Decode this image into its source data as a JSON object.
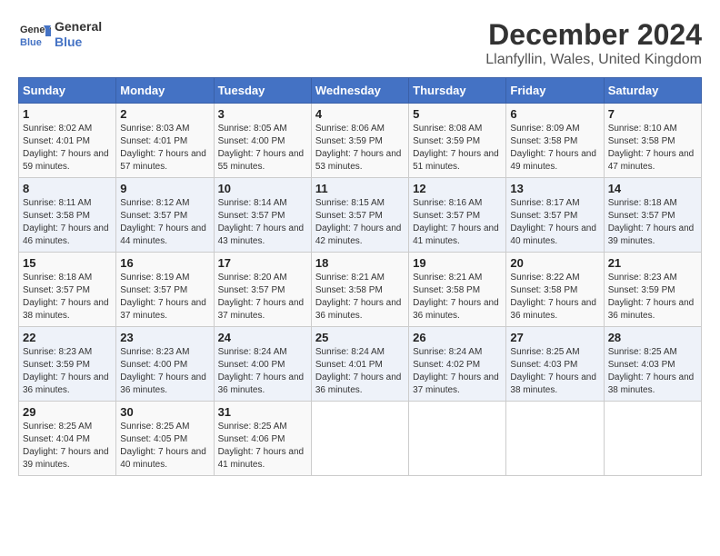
{
  "header": {
    "logo_line1": "General",
    "logo_line2": "Blue",
    "title": "December 2024",
    "subtitle": "Llanfyllin, Wales, United Kingdom"
  },
  "days_of_week": [
    "Sunday",
    "Monday",
    "Tuesday",
    "Wednesday",
    "Thursday",
    "Friday",
    "Saturday"
  ],
  "weeks": [
    [
      {
        "day": "1",
        "sunrise": "8:02 AM",
        "sunset": "4:01 PM",
        "daylight": "7 hours and 59 minutes."
      },
      {
        "day": "2",
        "sunrise": "8:03 AM",
        "sunset": "4:01 PM",
        "daylight": "7 hours and 57 minutes."
      },
      {
        "day": "3",
        "sunrise": "8:05 AM",
        "sunset": "4:00 PM",
        "daylight": "7 hours and 55 minutes."
      },
      {
        "day": "4",
        "sunrise": "8:06 AM",
        "sunset": "3:59 PM",
        "daylight": "7 hours and 53 minutes."
      },
      {
        "day": "5",
        "sunrise": "8:08 AM",
        "sunset": "3:59 PM",
        "daylight": "7 hours and 51 minutes."
      },
      {
        "day": "6",
        "sunrise": "8:09 AM",
        "sunset": "3:58 PM",
        "daylight": "7 hours and 49 minutes."
      },
      {
        "day": "7",
        "sunrise": "8:10 AM",
        "sunset": "3:58 PM",
        "daylight": "7 hours and 47 minutes."
      }
    ],
    [
      {
        "day": "8",
        "sunrise": "8:11 AM",
        "sunset": "3:58 PM",
        "daylight": "7 hours and 46 minutes."
      },
      {
        "day": "9",
        "sunrise": "8:12 AM",
        "sunset": "3:57 PM",
        "daylight": "7 hours and 44 minutes."
      },
      {
        "day": "10",
        "sunrise": "8:14 AM",
        "sunset": "3:57 PM",
        "daylight": "7 hours and 43 minutes."
      },
      {
        "day": "11",
        "sunrise": "8:15 AM",
        "sunset": "3:57 PM",
        "daylight": "7 hours and 42 minutes."
      },
      {
        "day": "12",
        "sunrise": "8:16 AM",
        "sunset": "3:57 PM",
        "daylight": "7 hours and 41 minutes."
      },
      {
        "day": "13",
        "sunrise": "8:17 AM",
        "sunset": "3:57 PM",
        "daylight": "7 hours and 40 minutes."
      },
      {
        "day": "14",
        "sunrise": "8:18 AM",
        "sunset": "3:57 PM",
        "daylight": "7 hours and 39 minutes."
      }
    ],
    [
      {
        "day": "15",
        "sunrise": "8:18 AM",
        "sunset": "3:57 PM",
        "daylight": "7 hours and 38 minutes."
      },
      {
        "day": "16",
        "sunrise": "8:19 AM",
        "sunset": "3:57 PM",
        "daylight": "7 hours and 37 minutes."
      },
      {
        "day": "17",
        "sunrise": "8:20 AM",
        "sunset": "3:57 PM",
        "daylight": "7 hours and 37 minutes."
      },
      {
        "day": "18",
        "sunrise": "8:21 AM",
        "sunset": "3:58 PM",
        "daylight": "7 hours and 36 minutes."
      },
      {
        "day": "19",
        "sunrise": "8:21 AM",
        "sunset": "3:58 PM",
        "daylight": "7 hours and 36 minutes."
      },
      {
        "day": "20",
        "sunrise": "8:22 AM",
        "sunset": "3:58 PM",
        "daylight": "7 hours and 36 minutes."
      },
      {
        "day": "21",
        "sunrise": "8:23 AM",
        "sunset": "3:59 PM",
        "daylight": "7 hours and 36 minutes."
      }
    ],
    [
      {
        "day": "22",
        "sunrise": "8:23 AM",
        "sunset": "3:59 PM",
        "daylight": "7 hours and 36 minutes."
      },
      {
        "day": "23",
        "sunrise": "8:23 AM",
        "sunset": "4:00 PM",
        "daylight": "7 hours and 36 minutes."
      },
      {
        "day": "24",
        "sunrise": "8:24 AM",
        "sunset": "4:00 PM",
        "daylight": "7 hours and 36 minutes."
      },
      {
        "day": "25",
        "sunrise": "8:24 AM",
        "sunset": "4:01 PM",
        "daylight": "7 hours and 36 minutes."
      },
      {
        "day": "26",
        "sunrise": "8:24 AM",
        "sunset": "4:02 PM",
        "daylight": "7 hours and 37 minutes."
      },
      {
        "day": "27",
        "sunrise": "8:25 AM",
        "sunset": "4:03 PM",
        "daylight": "7 hours and 38 minutes."
      },
      {
        "day": "28",
        "sunrise": "8:25 AM",
        "sunset": "4:03 PM",
        "daylight": "7 hours and 38 minutes."
      }
    ],
    [
      {
        "day": "29",
        "sunrise": "8:25 AM",
        "sunset": "4:04 PM",
        "daylight": "7 hours and 39 minutes."
      },
      {
        "day": "30",
        "sunrise": "8:25 AM",
        "sunset": "4:05 PM",
        "daylight": "7 hours and 40 minutes."
      },
      {
        "day": "31",
        "sunrise": "8:25 AM",
        "sunset": "4:06 PM",
        "daylight": "7 hours and 41 minutes."
      },
      null,
      null,
      null,
      null
    ]
  ]
}
